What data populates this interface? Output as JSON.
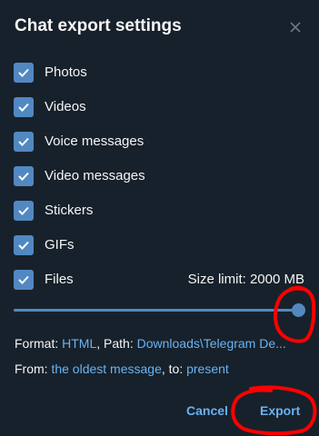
{
  "dialog": {
    "title": "Chat export settings",
    "close_icon": "close-icon"
  },
  "options": [
    {
      "label": "Photos",
      "checked": true
    },
    {
      "label": "Videos",
      "checked": true
    },
    {
      "label": "Voice messages",
      "checked": true
    },
    {
      "label": "Video messages",
      "checked": true
    },
    {
      "label": "Stickers",
      "checked": true
    },
    {
      "label": "GIFs",
      "checked": true
    },
    {
      "label": "Files",
      "checked": true
    }
  ],
  "size_limit": {
    "text": "Size limit: 2000 MB",
    "slider_fraction": 1.0
  },
  "format_line": {
    "prefix": "Format: ",
    "format_value": "HTML",
    "path_prefix": ", Path: ",
    "path_value": "Downloads\\Telegram De..."
  },
  "range_line": {
    "from_prefix": "From: ",
    "from_value": "the oldest message",
    "to_prefix": ", to: ",
    "to_value": "present"
  },
  "buttons": {
    "cancel_label": "Cancel",
    "export_label": "Export"
  },
  "colors": {
    "background": "#17212b",
    "accent": "#5288c1",
    "link": "#6ab2f2",
    "annotation": "#ff0000"
  }
}
